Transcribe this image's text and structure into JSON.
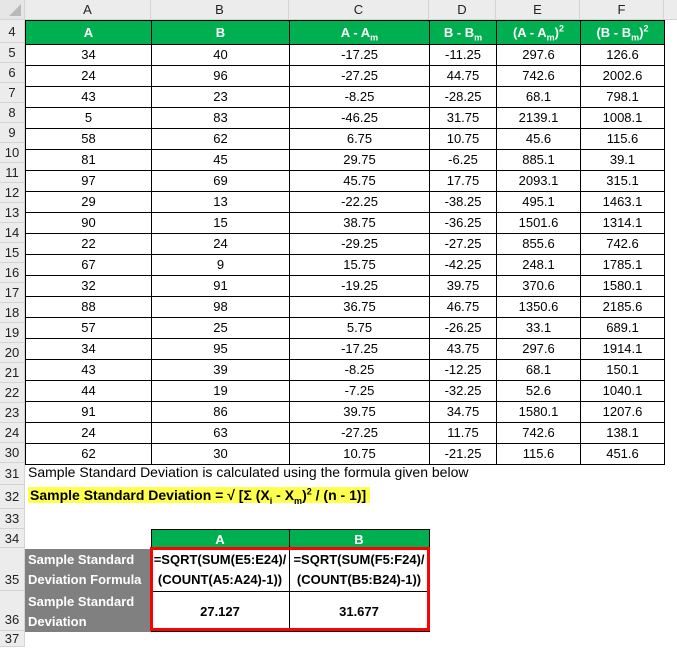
{
  "column_headers": [
    "A",
    "B",
    "C",
    "D",
    "E",
    "F"
  ],
  "row_numbers": [
    "4",
    "5",
    "6",
    "7",
    "8",
    "9",
    "10",
    "11",
    "12",
    "13",
    "14",
    "15",
    "16",
    "17",
    "18",
    "19",
    "20",
    "21",
    "22",
    "23",
    "24",
    "30",
    "31",
    "32",
    "33",
    "34",
    "35",
    "36",
    "37"
  ],
  "table": {
    "headers": [
      {
        "main": "A",
        "sub": "",
        "sup": ""
      },
      {
        "main": "B",
        "sub": "",
        "sup": ""
      },
      {
        "main": "A - A",
        "sub": "m",
        "sup": ""
      },
      {
        "main": "B - B",
        "sub": "m",
        "sup": ""
      },
      {
        "main": "(A - A",
        "sub": "m",
        "close": ")",
        "sup": "2"
      },
      {
        "main": "(B - B",
        "sub": "m",
        "close": ")",
        "sup": "2"
      }
    ],
    "rows": [
      [
        "34",
        "40",
        "-17.25",
        "-11.25",
        "297.6",
        "126.6"
      ],
      [
        "24",
        "96",
        "-27.25",
        "44.75",
        "742.6",
        "2002.6"
      ],
      [
        "43",
        "23",
        "-8.25",
        "-28.25",
        "68.1",
        "798.1"
      ],
      [
        "5",
        "83",
        "-46.25",
        "31.75",
        "2139.1",
        "1008.1"
      ],
      [
        "58",
        "62",
        "6.75",
        "10.75",
        "45.6",
        "115.6"
      ],
      [
        "81",
        "45",
        "29.75",
        "-6.25",
        "885.1",
        "39.1"
      ],
      [
        "97",
        "69",
        "45.75",
        "17.75",
        "2093.1",
        "315.1"
      ],
      [
        "29",
        "13",
        "-22.25",
        "-38.25",
        "495.1",
        "1463.1"
      ],
      [
        "90",
        "15",
        "38.75",
        "-36.25",
        "1501.6",
        "1314.1"
      ],
      [
        "22",
        "24",
        "-29.25",
        "-27.25",
        "855.6",
        "742.6"
      ],
      [
        "67",
        "9",
        "15.75",
        "-42.25",
        "248.1",
        "1785.1"
      ],
      [
        "32",
        "91",
        "-19.25",
        "39.75",
        "370.6",
        "1580.1"
      ],
      [
        "88",
        "98",
        "36.75",
        "46.75",
        "1350.6",
        "2185.6"
      ],
      [
        "57",
        "25",
        "5.75",
        "-26.25",
        "33.1",
        "689.1"
      ],
      [
        "34",
        "95",
        "-17.25",
        "43.75",
        "297.6",
        "1914.1"
      ],
      [
        "43",
        "39",
        "-8.25",
        "-12.25",
        "68.1",
        "150.1"
      ],
      [
        "44",
        "19",
        "-7.25",
        "-32.25",
        "52.6",
        "1040.1"
      ],
      [
        "91",
        "86",
        "39.75",
        "34.75",
        "1580.1",
        "1207.6"
      ],
      [
        "24",
        "63",
        "-27.25",
        "11.75",
        "742.6",
        "138.1"
      ],
      [
        "62",
        "30",
        "10.75",
        "-21.25",
        "115.6",
        "451.6"
      ]
    ]
  },
  "note": "Sample Standard Deviation is calculated using the formula given below",
  "formula": {
    "prefix": "Sample Standard Deviation = √ [Σ (X",
    "sub_i": "i",
    "mid": " - X",
    "sub_m": "m",
    "close": ")",
    "sup": "2",
    "suffix": " / (n - 1)]"
  },
  "sd_table": {
    "headers": [
      "A",
      "B"
    ],
    "formula_label_line1": "Sample Standard",
    "formula_label_line2": "Deviation Formula",
    "formula_a_line1": "=SQRT(SUM(E5:E24)/",
    "formula_a_line2": "(COUNT(A5:A24)-1))",
    "formula_b_line1": "=SQRT(SUM(F5:F24)/",
    "formula_b_line2": "(COUNT(B5:B24)-1))",
    "result_label_line1": "Sample Standard",
    "result_label_line2": "Deviation",
    "result_a": "27.127",
    "result_b": "31.677"
  },
  "colors": {
    "header_green": "#00b050",
    "label_gray": "#808080",
    "highlight_yellow": "#ffff4d",
    "box_red": "#ff0000"
  }
}
